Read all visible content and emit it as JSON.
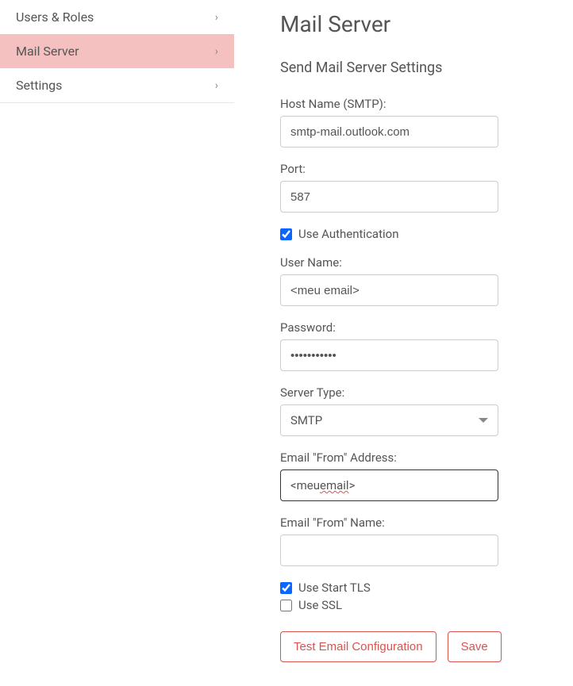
{
  "sidebar": {
    "items": [
      {
        "label": "Users & Roles",
        "active": false
      },
      {
        "label": "Mail Server",
        "active": true
      },
      {
        "label": "Settings",
        "active": false
      }
    ]
  },
  "page": {
    "title": "Mail Server",
    "subtitle": "Send Mail Server Settings"
  },
  "form": {
    "host_name": {
      "label": "Host Name (SMTP):",
      "value": "smtp-mail.outlook.com"
    },
    "port": {
      "label": "Port:",
      "value": "587"
    },
    "use_auth": {
      "label": "Use Authentication",
      "checked": true
    },
    "user_name": {
      "label": "User Name:",
      "value": "<meu email>"
    },
    "password": {
      "label": "Password:",
      "value": "•••••••••••"
    },
    "server_type": {
      "label": "Server Type:",
      "value": "SMTP"
    },
    "from_address": {
      "label": "Email \"From\" Address:",
      "value_pre": "<meu ",
      "value_squiggle": "email",
      "value_post": ">"
    },
    "from_name": {
      "label": "Email \"From\" Name:",
      "value": ""
    },
    "use_starttls": {
      "label": "Use Start TLS",
      "checked": true
    },
    "use_ssl": {
      "label": "Use SSL",
      "checked": false
    }
  },
  "buttons": {
    "test": "Test Email Configuration",
    "save": "Save"
  }
}
